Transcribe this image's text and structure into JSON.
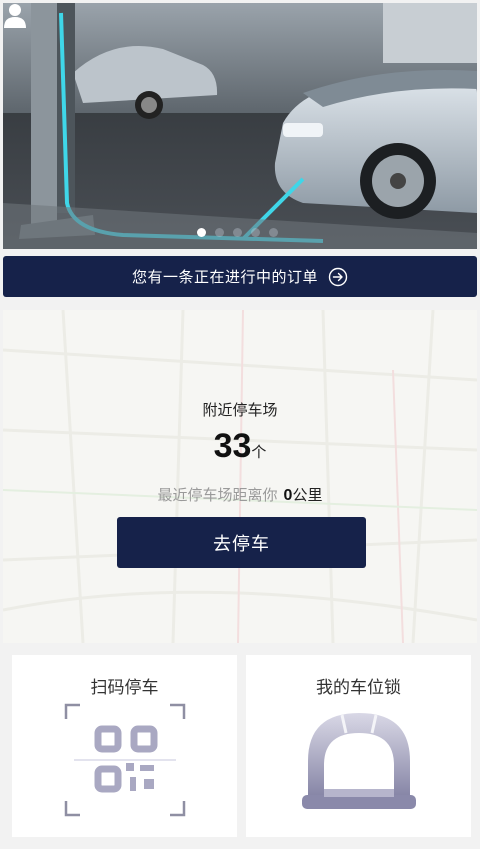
{
  "order_bar": {
    "text": "您有一条正在进行中的订单",
    "icon": "arrow-right-circle-icon"
  },
  "banner": {
    "slides": 5,
    "active_slide": 1,
    "user_icon": "user-icon"
  },
  "parking": {
    "title": "附近停车场",
    "count": "33",
    "count_unit": "个",
    "distance_label": "最近停车场距离你",
    "distance_value": "0",
    "distance_unit": "公里",
    "go_button": "去停车"
  },
  "cards": {
    "scan": {
      "title": "扫码停车",
      "icon": "qr-code-icon"
    },
    "lock": {
      "title": "我的车位锁",
      "icon": "parking-lock-icon"
    }
  },
  "colors": {
    "navy": "#16224a",
    "accent_cyan": "#3fd6e8",
    "background": "#f2f2f2"
  }
}
